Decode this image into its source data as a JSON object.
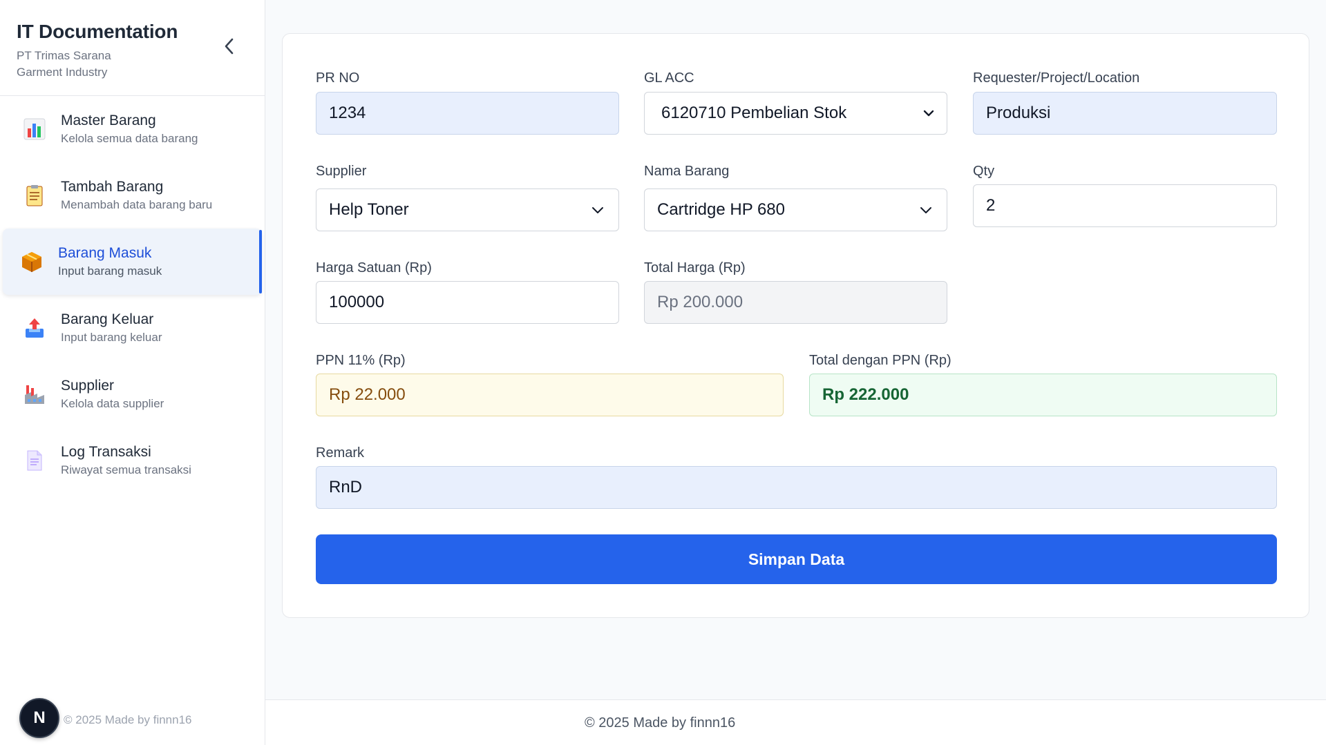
{
  "sidebar": {
    "title": "IT Documentation",
    "subtitle": "PT Trimas Sarana Garment Industry",
    "items": [
      {
        "label": "Master Barang",
        "desc": "Kelola semua data barang",
        "icon": "bar-chart-icon"
      },
      {
        "label": "Tambah Barang",
        "desc": "Menambah data barang baru",
        "icon": "clipboard-icon"
      },
      {
        "label": "Barang Masuk",
        "desc": "Input barang masuk",
        "icon": "package-icon",
        "active": true
      },
      {
        "label": "Barang Keluar",
        "desc": "Input barang keluar",
        "icon": "outbox-tray-icon"
      },
      {
        "label": "Supplier",
        "desc": "Kelola data supplier",
        "icon": "factory-icon"
      },
      {
        "label": "Log Transaksi",
        "desc": "Riwayat semua transaksi",
        "icon": "document-icon"
      }
    ],
    "avatar_letter": "N",
    "footer": "© 2025 Made by finnn16"
  },
  "form": {
    "pr_no": {
      "label": "PR NO",
      "value": "1234"
    },
    "gl_acc": {
      "label": "GL ACC",
      "value": "6120710 Pembelian Stok"
    },
    "requester": {
      "label": "Requester/Project/Location",
      "value": "Produksi"
    },
    "supplier": {
      "label": "Supplier",
      "value": "Help Toner"
    },
    "nama_barang": {
      "label": "Nama Barang",
      "value": "Cartridge HP 680"
    },
    "qty": {
      "label": "Qty",
      "value": "2"
    },
    "harga_satuan": {
      "label": "Harga Satuan (Rp)",
      "value": "100000"
    },
    "total_harga": {
      "label": "Total Harga (Rp)",
      "value": "Rp 200.000"
    },
    "ppn": {
      "label": "PPN 11% (Rp)",
      "value": "Rp 22.000"
    },
    "total_ppn": {
      "label": "Total dengan PPN (Rp)",
      "value": "Rp 222.000"
    },
    "remark": {
      "label": "Remark",
      "value": "RnD"
    },
    "save_label": "Simpan Data"
  },
  "footer": {
    "copyright": "© 2025 Made by finnn16"
  },
  "colors": {
    "accent": "#2563eb",
    "active_bg": "#eef3fb"
  }
}
